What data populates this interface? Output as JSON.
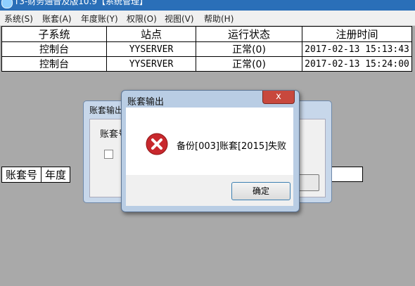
{
  "window": {
    "title": "T3-财务通普及版10.9【系统管理】"
  },
  "menu": [
    "系统(S)",
    "账套(A)",
    "年度账(Y)",
    "权限(O)",
    "视图(V)",
    "帮助(H)"
  ],
  "grid": {
    "headers": [
      "子系统",
      "站点",
      "运行状态",
      "注册时间"
    ],
    "rows": [
      [
        "控制台",
        "YYSERVER",
        "正常(0)",
        "2017-02-13 15:13:43"
      ],
      [
        "控制台",
        "YYSERVER",
        "正常(0)",
        "2017-02-13 15:24:00"
      ]
    ]
  },
  "lower_grid": {
    "headers": [
      "账套号",
      "年度"
    ]
  },
  "bg_dialog": {
    "title": "账套输出",
    "label": "账套号"
  },
  "message_box": {
    "title": "账套输出",
    "close_glyph": "x",
    "message": "备份[003]账套[2015]失败",
    "ok_label": "确定",
    "icon": "error-icon"
  },
  "colors": {
    "error_red": "#c8282d",
    "title_bar": "#2a6fb8"
  }
}
